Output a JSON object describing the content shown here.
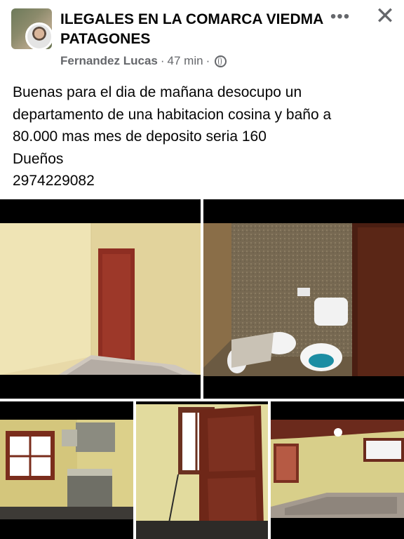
{
  "post": {
    "group_name": "ILEGALES EN LA COMARCA VIEDMA PATAGONES",
    "author": "Fernandez Lucas",
    "time": "47 min",
    "separator": "·",
    "more_icon": "more-icon",
    "close_icon": "close-icon",
    "body_lines": [
      "Buenas para el dia de mañana desocupo un",
      "departamento de una habitacion cosina y baño a",
      "80.000 mas mes de deposito seria 160",
      "Dueños",
      "2974229082"
    ]
  },
  "photos": [
    {
      "subject": "empty room with red wooden door"
    },
    {
      "subject": "bathroom with toilet and bidet"
    },
    {
      "subject": "kitchen with window and cabinets"
    },
    {
      "subject": "wooden door and window"
    },
    {
      "subject": "empty room with windows"
    }
  ]
}
